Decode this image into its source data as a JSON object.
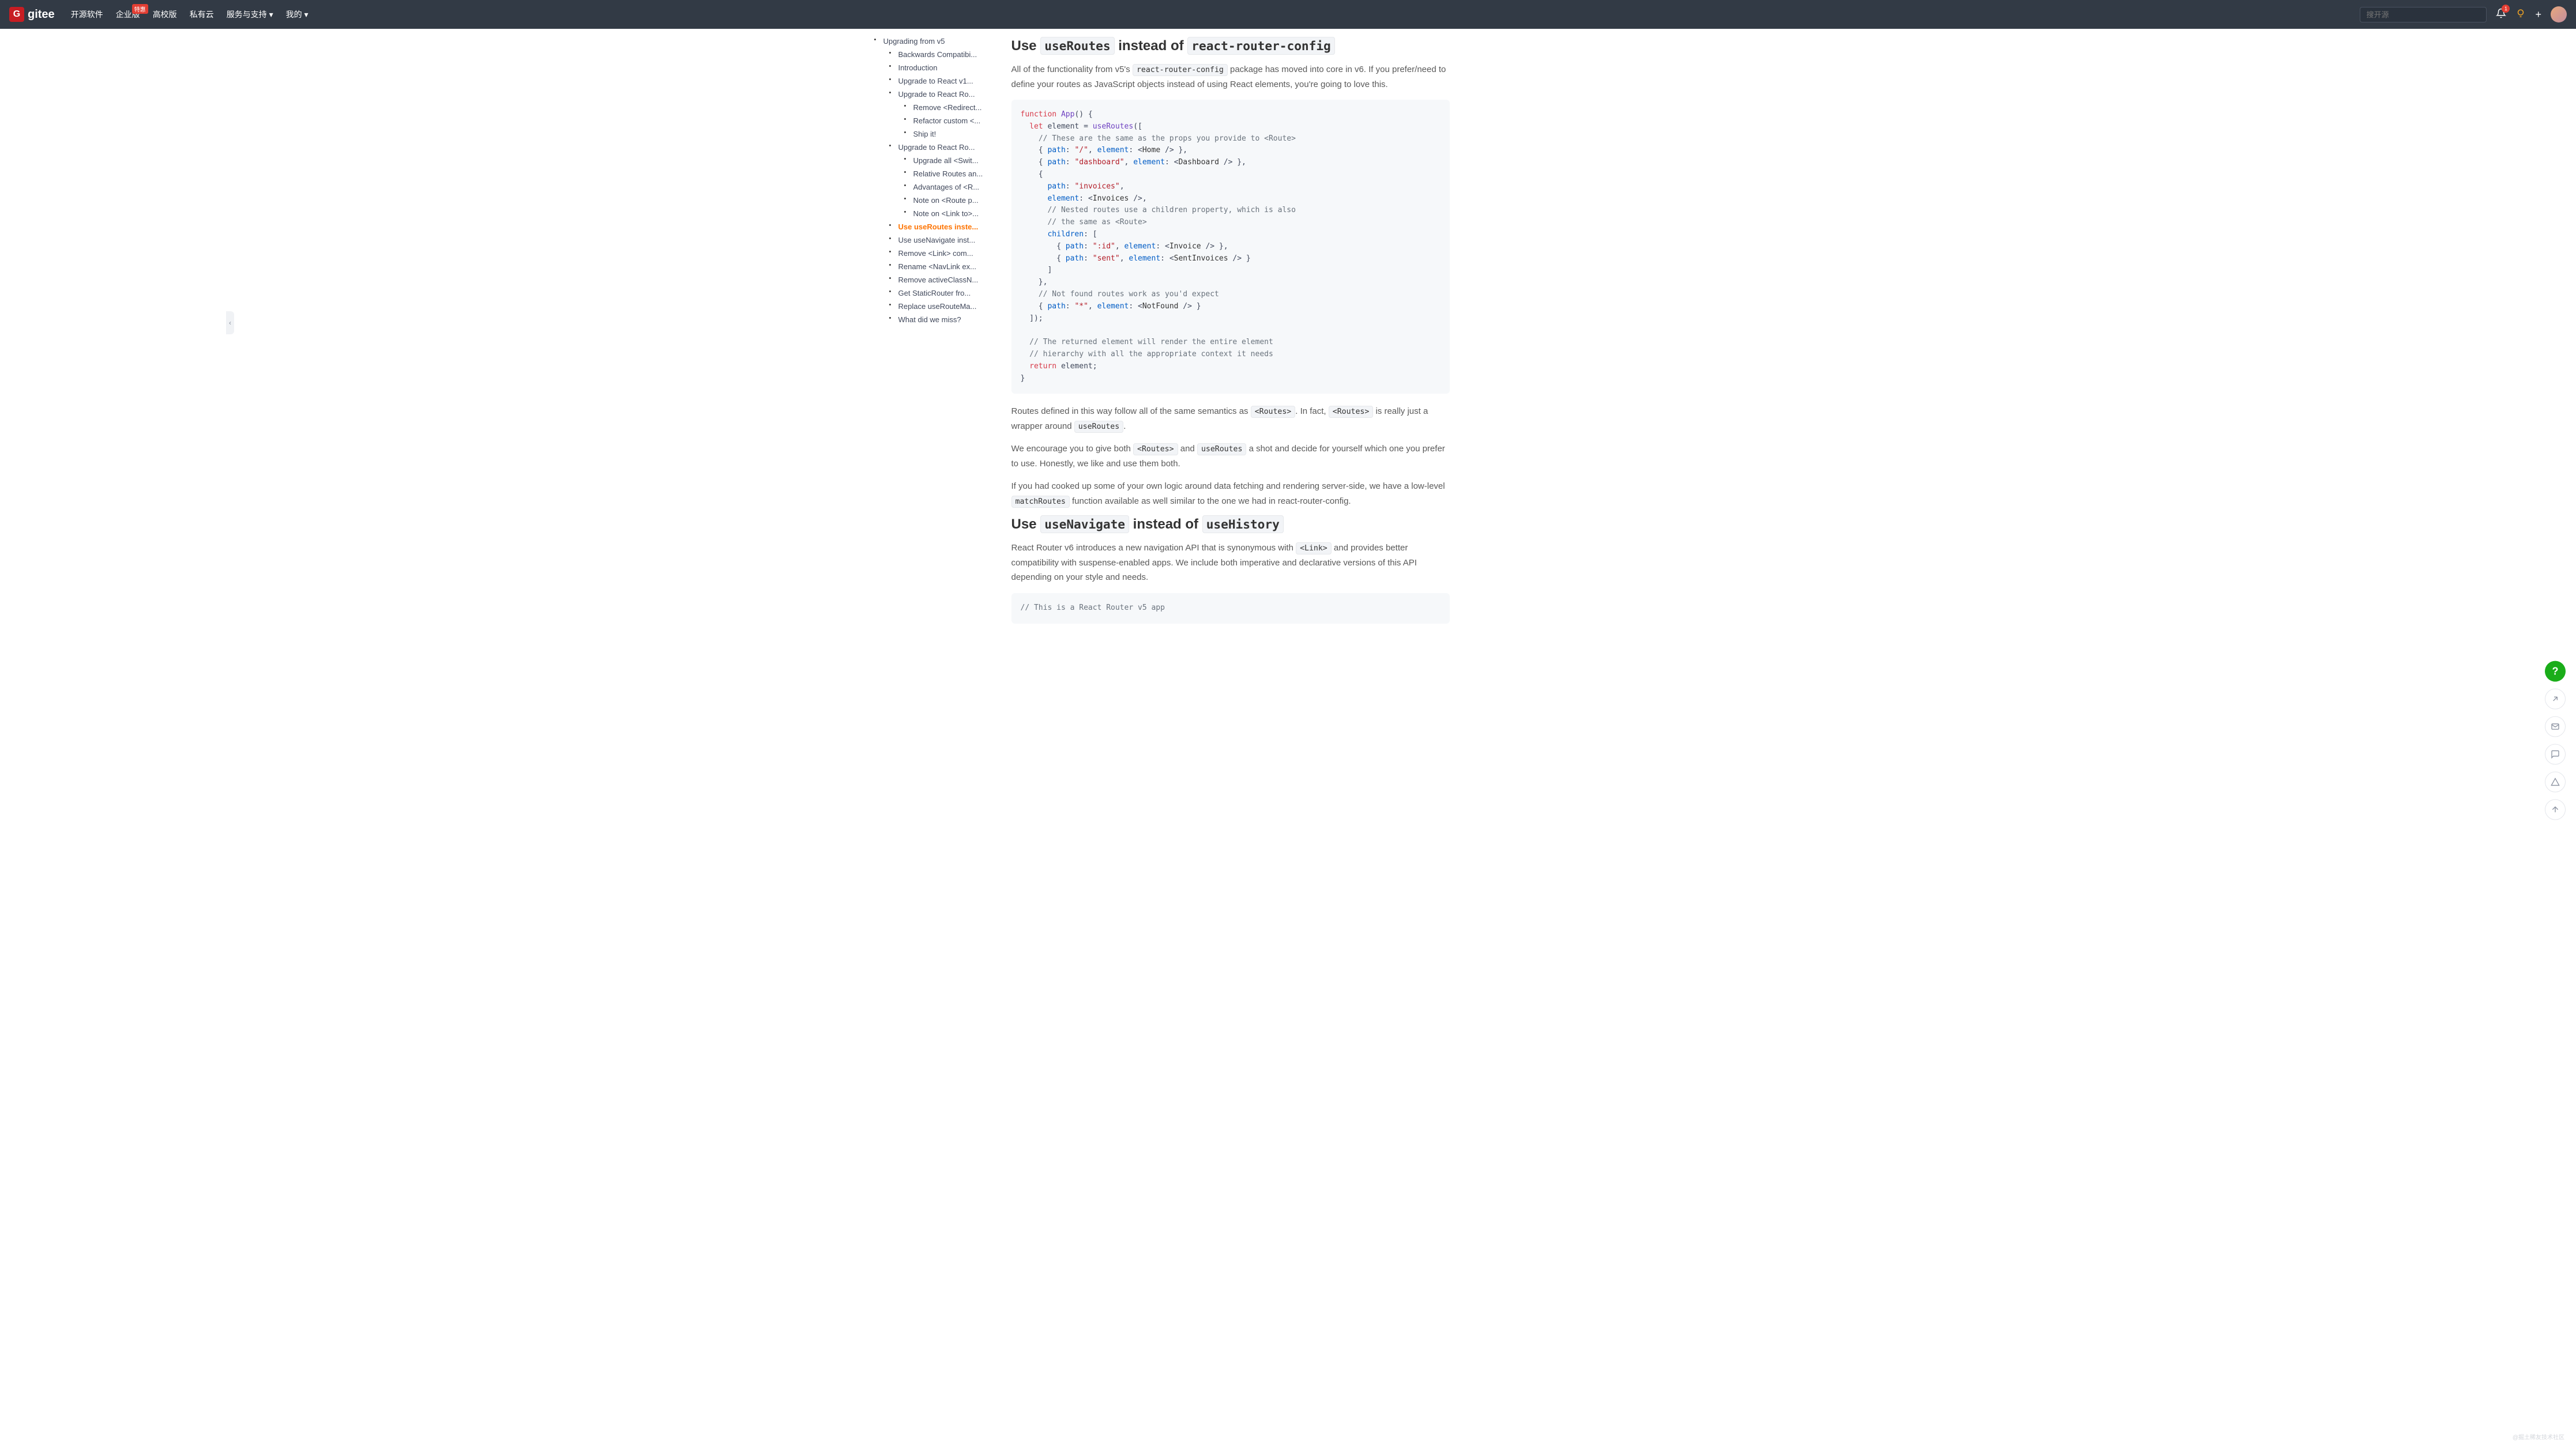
{
  "nav": {
    "logo_text": "gitee",
    "items": [
      "开源软件",
      "企业版",
      "高校版",
      "私有云",
      "服务与支持",
      "我的"
    ],
    "badge_on": 1,
    "badge_text": "特惠",
    "dropdown_on": [
      4,
      5
    ],
    "search_placeholder": "搜开源",
    "notification_count": "1"
  },
  "toc": {
    "root": "Upgrading from v5",
    "items": [
      {
        "label": "Backwards Compatibi...",
        "active": false
      },
      {
        "label": "Introduction",
        "active": false
      },
      {
        "label": "Upgrade to React v1...",
        "active": false
      },
      {
        "label": "Upgrade to React Ro...",
        "active": false,
        "children": [
          {
            "label": "Remove <Redirect...",
            "active": false
          },
          {
            "label": "Refactor custom <...",
            "active": false
          },
          {
            "label": "Ship it!",
            "active": false
          }
        ]
      },
      {
        "label": "Upgrade to React Ro...",
        "active": false,
        "children": [
          {
            "label": "Upgrade all <Swit...",
            "active": false
          },
          {
            "label": "Relative Routes an...",
            "active": false
          },
          {
            "label": "Advantages of <R...",
            "active": false
          },
          {
            "label": "Note on <Route p...",
            "active": false
          },
          {
            "label": "Note on <Link to>...",
            "active": false
          }
        ]
      },
      {
        "label": "Use useRoutes inste...",
        "active": true
      },
      {
        "label": "Use useNavigate inst...",
        "active": false
      },
      {
        "label": "Remove <Link> com...",
        "active": false
      },
      {
        "label": "Rename <NavLink ex...",
        "active": false
      },
      {
        "label": "Remove activeClassN...",
        "active": false
      },
      {
        "label": "Get StaticRouter fro...",
        "active": false
      },
      {
        "label": "Replace useRouteMa...",
        "active": false
      },
      {
        "label": "What did we miss?",
        "active": false
      }
    ]
  },
  "content": {
    "h1_pre": "Use ",
    "h1_code1": "useRoutes",
    "h1_mid": " instead of ",
    "h1_code2": "react-router-config",
    "p1_pre": "All of the functionality from v5's ",
    "p1_code": "react-router-config",
    "p1_post": " package has moved into core in v6. If you prefer/need to define your routes as JavaScript objects instead of using React elements, you're going to love this.",
    "p2_pre": "Routes defined in this way follow all of the same semantics as ",
    "p2_c1": "<Routes>",
    "p2_mid1": ". In fact, ",
    "p2_c2": "<Routes>",
    "p2_mid2": " is really just a wrapper around ",
    "p2_c3": "useRoutes",
    "p2_post": ".",
    "p3_pre": "We encourage you to give both ",
    "p3_c1": "<Routes>",
    "p3_mid1": " and ",
    "p3_c2": "useRoutes",
    "p3_post": " a shot and decide for yourself which one you prefer to use. Honestly, we like and use them both.",
    "p4_pre": "If you had cooked up some of your own logic around data fetching and rendering server-side, we have a low-level ",
    "p4_c1": "matchRoutes",
    "p4_post": " function available as well similar to the one we had in react-router-config.",
    "h2_pre": "Use ",
    "h2_code1": "useNavigate",
    "h2_mid": " instead of ",
    "h2_code2": "useHistory",
    "p5_pre": "React Router v6 introduces a new navigation API that is synonymous with ",
    "p5_c1": "<Link>",
    "p5_post": " and provides better compatibility with suspense-enabled apps. We include both imperative and declarative versions of this API depending on your style and needs.",
    "code2_comment": "// This is a React Router v5 app"
  },
  "watermark": "@掘土稀友技术社区",
  "icons": {
    "help": "?",
    "share": "↗",
    "mail": "✉",
    "comment": "💬",
    "warn": "△",
    "top": "↑"
  }
}
